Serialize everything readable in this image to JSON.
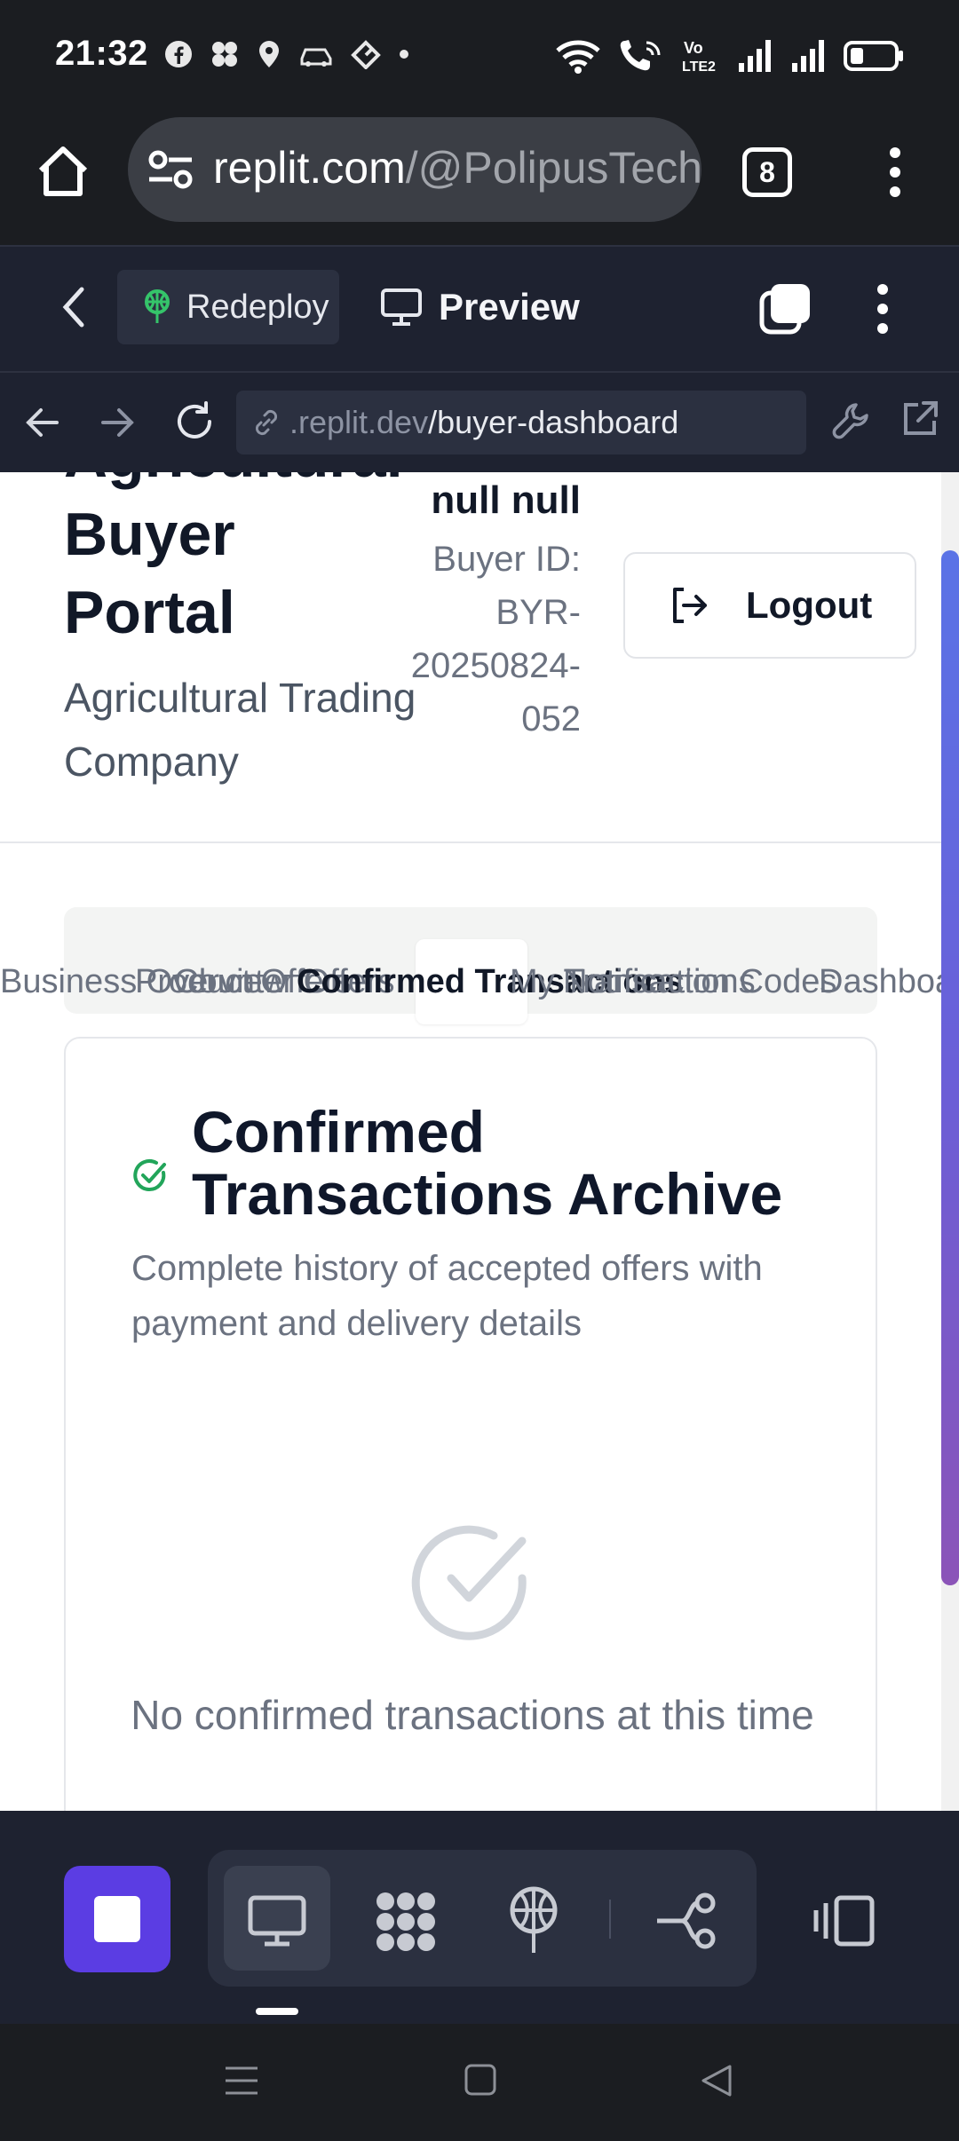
{
  "status_bar": {
    "time": "21:32"
  },
  "browser": {
    "url_host": "replit.com",
    "url_path": "/@PolipusTech",
    "tab_count": "8"
  },
  "replit_header": {
    "redeploy_label": "Redeploy",
    "preview_label": "Preview"
  },
  "preview_bar": {
    "url_dim": ".replit.dev",
    "url_path": "/buyer-dashboard"
  },
  "page": {
    "brand_title_lines": [
      "Agricultural",
      "Buyer",
      "Portal"
    ],
    "brand_title": "Agricultural Buyer Portal",
    "brand_subtitle": "Agricultural Trading Company",
    "user_name": "null null",
    "buyer_id_label": "Buyer ID:",
    "buyer_id": "BYR-20250824-052",
    "logout_label": "Logout",
    "tabs": [
      {
        "label": "Business Overview"
      },
      {
        "label": "Product Offers"
      },
      {
        "label": "Counter Offers"
      },
      {
        "label": "Confirmed Transactions",
        "active": true
      },
      {
        "label": "My Transactions"
      },
      {
        "label": "Notification Codes"
      },
      {
        "label": "Dashboard"
      }
    ],
    "card": {
      "title": "Confirmed Transactions Archive",
      "description": "Complete history of accepted offers with payment and delivery details",
      "empty_message": "No confirmed transactions at this time"
    }
  },
  "colors": {
    "accent_purple": "#5b3de3",
    "success_green": "#22a55a",
    "scrollbar_top": "#5a73e6",
    "scrollbar_bottom": "#8b54b8"
  },
  "icons": {
    "status": [
      "facebook-icon",
      "app-icon",
      "location-icon",
      "car-icon",
      "hotspot-icon",
      "wifi-icon",
      "wifi-call-icon",
      "volte-icon",
      "signal-icon",
      "battery-icon"
    ],
    "toolbar": [
      "stop-icon",
      "monitor-icon",
      "agent-icon",
      "deploy-icon",
      "git-icon",
      "layout-icon"
    ]
  }
}
